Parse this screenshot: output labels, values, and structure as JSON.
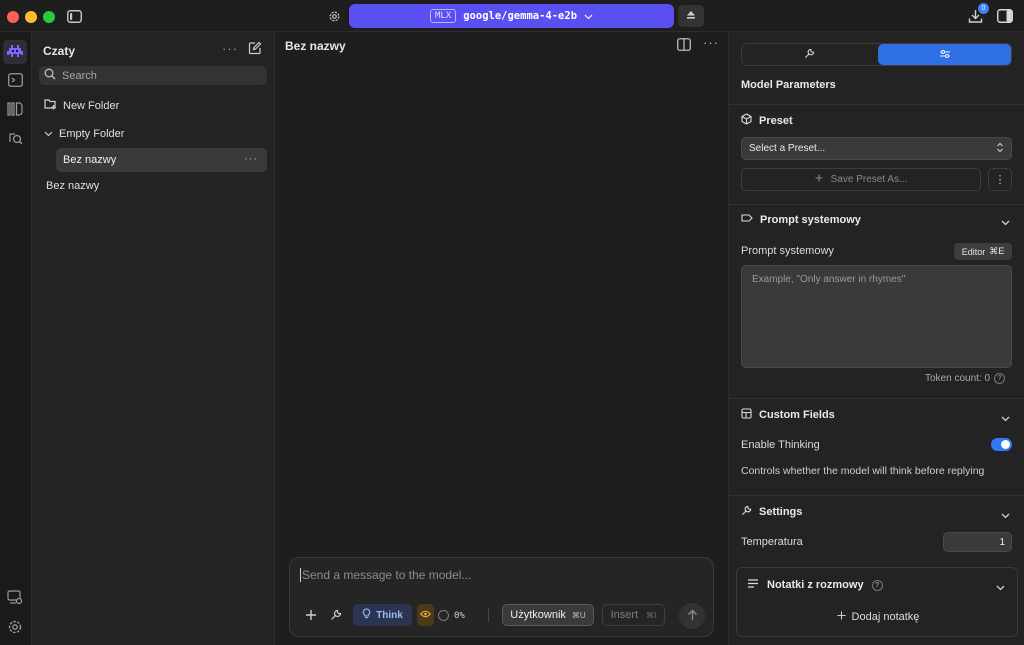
{
  "colors": {
    "accent_purple": "#5a4ff0",
    "accent_blue": "#2f6fe4",
    "toggle_on": "#2f7af0",
    "bg": "#1f1f1f"
  },
  "titlebar": {
    "model_badge": "MLX",
    "model_name": "google/gemma-4-e2b",
    "downloads_count": "0"
  },
  "rail": {
    "items": [
      "app-logo-icon",
      "terminal-icon",
      "models-icon",
      "discover-icon"
    ],
    "bottom_items": [
      "developer-icon",
      "settings-icon"
    ]
  },
  "sidebar": {
    "title": "Czaty",
    "search_placeholder": "Search",
    "new_folder": "New Folder",
    "folder_name": "Empty Folder",
    "folder_chat": "Bez nazwy",
    "root_chat": "Bez nazwy"
  },
  "main": {
    "chat_title": "Bez nazwy",
    "composer_placeholder": "Send a message to the model...",
    "think_label": "Think",
    "context_percent": "0%",
    "role_label": "Użytkownik",
    "role_shortcut": "⌘U",
    "insert_label": "Insert",
    "insert_shortcut": "⌘I"
  },
  "panel": {
    "heading": "Model Parameters",
    "preset": {
      "title": "Preset",
      "select_value": "Select a Preset...",
      "save_label": "Save Preset As..."
    },
    "system_prompt": {
      "title": "Prompt systemowy",
      "label": "Prompt systemowy",
      "editor_label": "Editor",
      "editor_shortcut": "⌘E",
      "placeholder": "Example, \"Only answer in rhymes\"",
      "token_count": "Token count: 0"
    },
    "custom_fields": {
      "title": "Custom Fields",
      "enable_thinking_label": "Enable Thinking",
      "enable_thinking_on": true,
      "hint": "Controls whether the model will think before replying"
    },
    "settings": {
      "title": "Settings",
      "temperature_label": "Temperatura",
      "temperature_value": "1"
    },
    "notes": {
      "title": "Notatki z rozmowy",
      "add_label": "Dodaj notatkę"
    }
  }
}
